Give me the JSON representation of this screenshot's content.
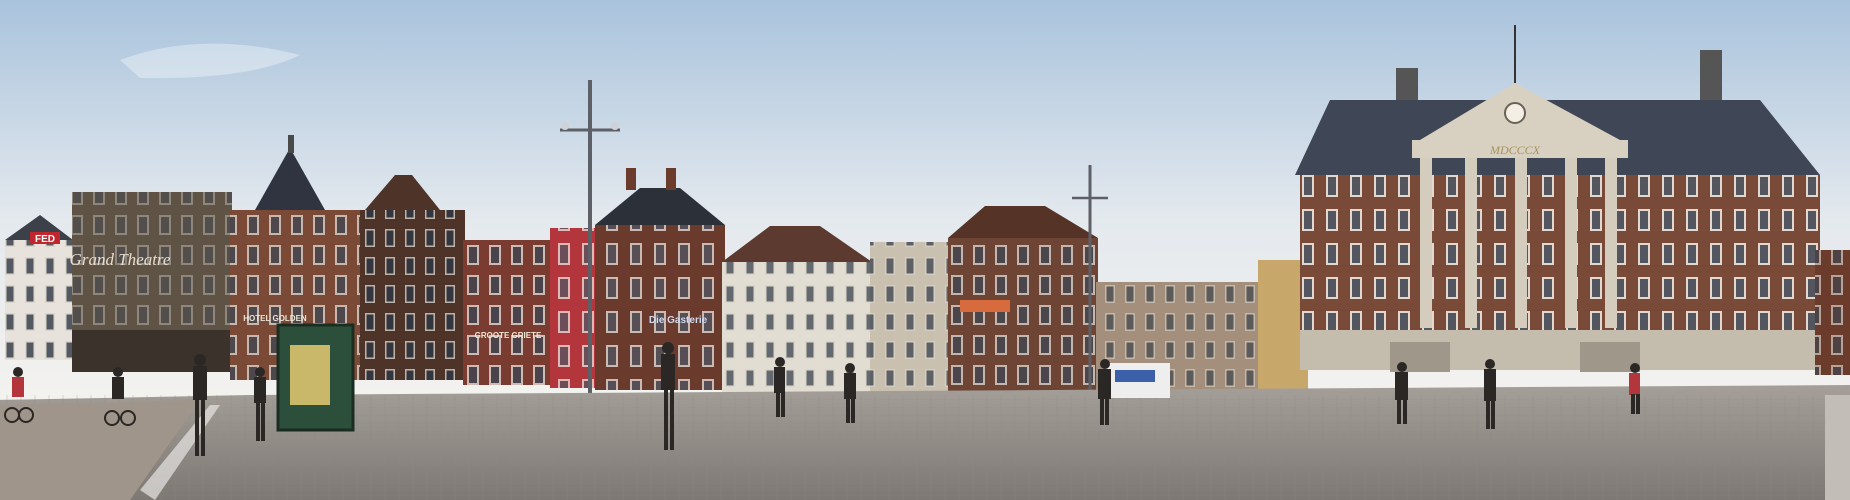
{
  "photo": {
    "sky_top": "#b9cde0",
    "sky_horizon": "#f2f1ee",
    "pavement": "#8e8a86",
    "pavement_shadow": "#6f6b68",
    "brick": "#6b3b2c",
    "stone": "#d8d1c2",
    "slate_roof": "#3a3f4a"
  },
  "signs": {
    "theatre": "Grand Theatre",
    "fed": "FED",
    "hotel": "HOTEL GOLDEN",
    "groote": "GROOTE GRIETE",
    "gasthuis": "Die Gasterie",
    "city_hall_date": "MDCCCX"
  }
}
